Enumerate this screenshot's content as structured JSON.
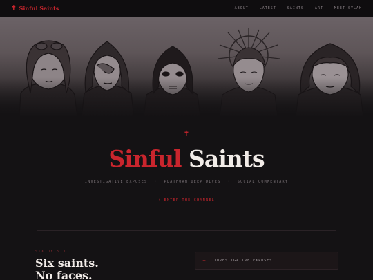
{
  "brand": {
    "name": "Sinful Saints",
    "icon": "cross-icon"
  },
  "nav": {
    "links": [
      "ABOUT",
      "LATEST",
      "SAINTS",
      "ART",
      "MEET SYLAH"
    ]
  },
  "hero": {
    "illustration": "five-hooded-saints-illustration"
  },
  "title": {
    "word1": "Sinful",
    "word2": "Saints"
  },
  "tags": [
    "INVESTIGATIVE EXPOSES",
    "PLATFORM DEEP DIVES",
    "SOCIAL COMMENTARY"
  ],
  "tag_separator": "·",
  "cta": {
    "label": "+ ENTER THE CHANNEL"
  },
  "section": {
    "kicker": "SIX OF SIX",
    "heading_line1": "Six saints.",
    "heading_line2": "No faces."
  },
  "card": {
    "icon": "+",
    "label": "INVESTIGATIVE EXPOSES"
  },
  "colors": {
    "accent": "#c9252d",
    "background": "#141214",
    "text": "#f2ece8"
  }
}
